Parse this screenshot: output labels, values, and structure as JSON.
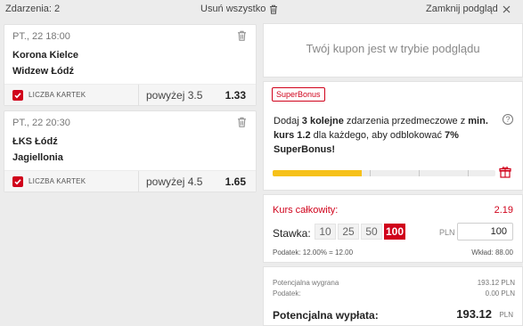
{
  "header": {
    "events_label": "Zdarzenia: 2",
    "remove_all": "Usuń wszystko",
    "close_preview": "Zamknij podgląd"
  },
  "bets": [
    {
      "date": "PT., 22   18:00",
      "home": "Korona Kielce",
      "away": "Widzew Łódź",
      "market": "LICZBA KARTEK",
      "pick": "powyżej 3.5",
      "odd": "1.33"
    },
    {
      "date": "PT., 22   20:30",
      "home": "ŁKS Łódź",
      "away": "Jagiellonia",
      "market": "LICZBA KARTEK",
      "pick": "powyżej 4.5",
      "odd": "1.65"
    }
  ],
  "preview": {
    "message": "Twój kupon jest w trybie podglądu"
  },
  "superbonus": {
    "badge": "SuperBonus",
    "t1": "Dodaj ",
    "t2": "3 kolejne",
    "t3": " zdarzenia przedmeczowe z ",
    "t4": "min. kurs 1.2",
    "t5": " dla każdego, aby odblokować ",
    "t6": "7% SuperBonus!",
    "help": "?",
    "progress": 0.4
  },
  "stake": {
    "kurs_label": "Kurs całkowity:",
    "kurs_value": "2.19",
    "stawka_label": "Stawka:",
    "chips": [
      "10",
      "25",
      "50",
      "100"
    ],
    "active_chip": "100",
    "currency": "PLN",
    "amount": "100",
    "tax_note": "Podatek: 12.00% = 12.00",
    "wklad": "Wkład: 88.00"
  },
  "summary": {
    "win_label": "Potencjalna wygrana",
    "win_value": "193.12  PLN",
    "tax_label": "Podatek:",
    "tax_value": "0.00  PLN",
    "payout_label": "Potencjalna wypłata:",
    "payout_value": "193.12",
    "payout_currency": "PLN"
  },
  "colors": {
    "accent": "#d0021b",
    "progress": "#f6c11a"
  }
}
